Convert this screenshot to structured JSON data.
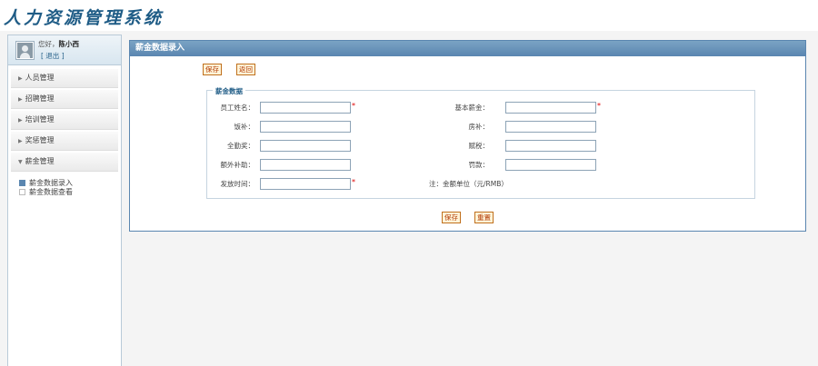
{
  "app": {
    "title": "人力资源管理系统"
  },
  "user": {
    "greeting": "您好，",
    "name": "陈小西",
    "logout": "[ 退出 ]"
  },
  "menu": [
    {
      "label": "人员管理"
    },
    {
      "label": "招聘管理"
    },
    {
      "label": "培训管理"
    },
    {
      "label": "奖惩管理"
    },
    {
      "label": "薪金管理"
    }
  ],
  "submenu": [
    {
      "label": "薪金数据录入"
    },
    {
      "label": "薪金数据查看"
    }
  ],
  "panel": {
    "title": "薪金数据录入"
  },
  "toolbar": {
    "save": "保存",
    "back": "返回"
  },
  "form": {
    "legend": "薪金数据",
    "employee_name": {
      "label": "员工姓名：",
      "value": ""
    },
    "base_salary": {
      "label": "基本薪金：",
      "value": ""
    },
    "meal_allowance": {
      "label": "饭补：",
      "value": ""
    },
    "housing_allowance": {
      "label": "房补：",
      "value": ""
    },
    "attendance_bonus": {
      "label": "全勤奖：",
      "value": ""
    },
    "tax": {
      "label": "赋税：",
      "value": ""
    },
    "extra_allowance": {
      "label": "额外补助：",
      "value": ""
    },
    "fine": {
      "label": "罚款：",
      "value": ""
    },
    "pay_date": {
      "label": "发放时间：",
      "value": ""
    },
    "required_mark": "*",
    "note": "注：金额单位（元/RMB）"
  },
  "footer": {
    "save": "保存",
    "reset": "重置"
  }
}
